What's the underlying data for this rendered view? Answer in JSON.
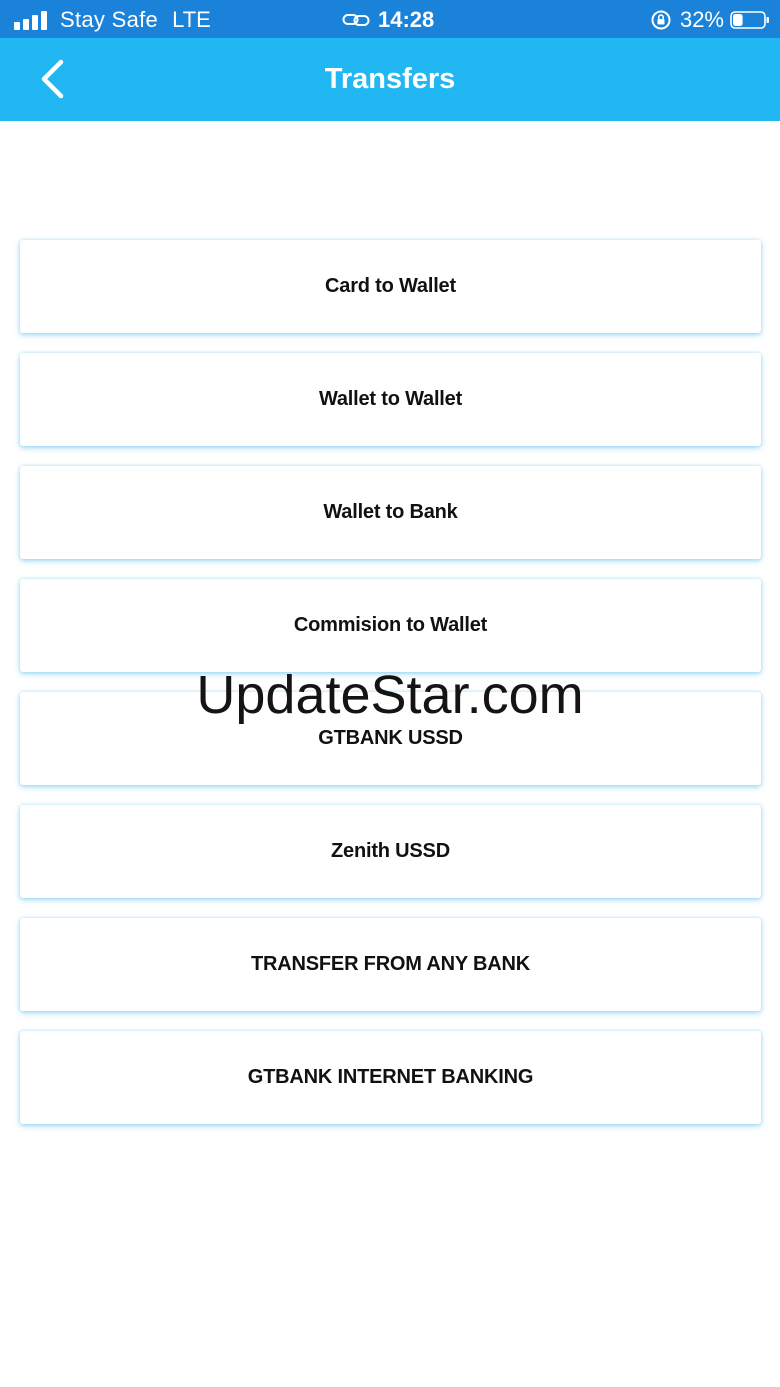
{
  "status_bar": {
    "carrier": "Stay Safe",
    "network": "LTE",
    "time": "14:28",
    "battery_percent": "32%",
    "battery_level": 0.32
  },
  "nav": {
    "title": "Transfers"
  },
  "menu": {
    "items": [
      {
        "label": "Card to Wallet"
      },
      {
        "label": "Wallet to Wallet"
      },
      {
        "label": "Wallet to Bank"
      },
      {
        "label": "Commision to Wallet"
      },
      {
        "label": "GTBANK USSD"
      },
      {
        "label": "Zenith USSD"
      },
      {
        "label": "TRANSFER FROM ANY BANK"
      },
      {
        "label": "GTBANK INTERNET BANKING"
      }
    ]
  },
  "watermark": "UpdateStar.com",
  "colors": {
    "status_bar": "#1a82d8",
    "nav_bar": "#21b7f2",
    "item_shadow": "#5abeeb"
  }
}
